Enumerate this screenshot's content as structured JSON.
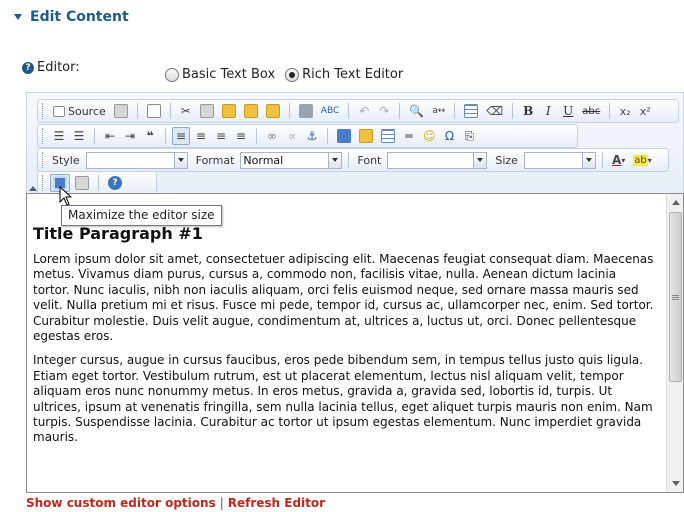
{
  "section": {
    "title": "Edit Content"
  },
  "editor_field": {
    "label": "Editor:",
    "options": [
      {
        "label": "Basic Text Box",
        "checked": false
      },
      {
        "label": "Rich Text Editor",
        "checked": true
      }
    ]
  },
  "toolbar": {
    "source_label": "Source",
    "style_label": "Style",
    "style_value": "",
    "format_label": "Format",
    "format_value": "Normal",
    "font_label": "Font",
    "font_value": "",
    "size_label": "Size",
    "size_value": "",
    "bold": "B",
    "italic": "I",
    "underline": "U",
    "strike": "abc",
    "subscript": "x₂",
    "superscript": "x²",
    "quote": "❝",
    "omega": "Ω",
    "text_color": "A",
    "bg_color": "ab"
  },
  "tooltip": {
    "text": "Maximize the editor size"
  },
  "content": {
    "heading": "Title Paragraph #1",
    "paragraphs": [
      "Lorem ipsum dolor sit amet, consectetuer adipiscing elit. Maecenas feugiat consequat diam. Maecenas metus. Vivamus diam purus, cursus a, commodo non, facilisis vitae, nulla. Aenean dictum lacinia tortor. Nunc iaculis, nibh non iaculis aliquam, orci felis euismod neque, sed ornare massa mauris sed velit. Nulla pretium mi et risus. Fusce mi pede, tempor id, cursus ac, ullamcorper nec, enim. Sed tortor. Curabitur molestie. Duis velit augue, condimentum at, ultrices a, luctus ut, orci. Donec pellentesque egestas eros.",
      "Integer cursus, augue in cursus faucibus, eros pede bibendum sem, in tempus tellus justo quis ligula. Etiam eget tortor. Vestibulum rutrum, est ut placerat elementum, lectus nisl aliquam velit, tempor aliquam eros nunc nonummy metus. In eros metus, gravida a, gravida sed, lobortis id, turpis. Ut ultrices, ipsum at venenatis fringilla, sem nulla lacinia tellus, eget aliquet turpis mauris non enim. Nam turpis. Suspendisse lacinia. Curabitur ac tortor ut ipsum egestas elementum. Nunc imperdiet gravida mauris."
    ]
  },
  "footer": {
    "show_options": "Show custom editor options",
    "separator": "|",
    "refresh": "Refresh Editor"
  },
  "colors": {
    "header_blue": "#1f5b8a",
    "link_red": "#c0281e"
  }
}
